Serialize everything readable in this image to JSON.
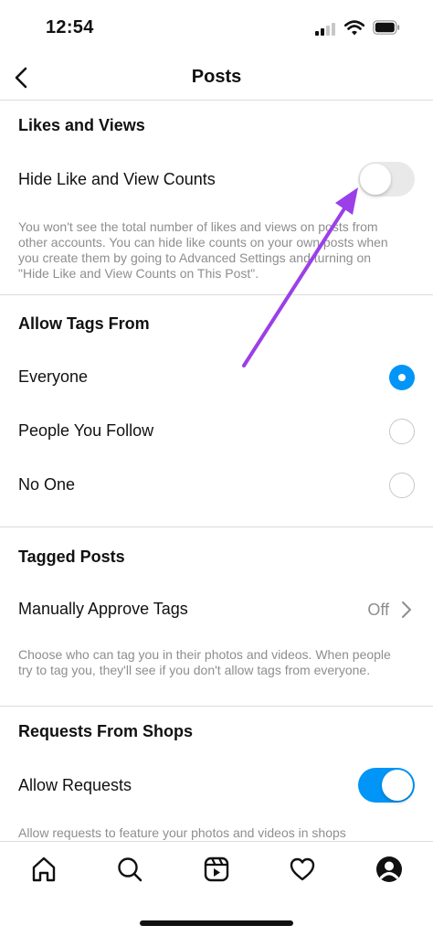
{
  "status_bar": {
    "time": "12:54"
  },
  "nav": {
    "title": "Posts"
  },
  "likes_views": {
    "title": "Likes and Views",
    "hide_counts_label": "Hide Like and View Counts",
    "hide_counts_enabled": false,
    "helper": "You won't see the total number of likes and views on posts from other accounts. You can hide like counts on your own posts when you create them by going to Advanced Settings and turning on \"Hide Like and View Counts on This Post\"."
  },
  "allow_tags": {
    "title": "Allow Tags From",
    "options": [
      {
        "label": "Everyone",
        "selected": true
      },
      {
        "label": "People You Follow",
        "selected": false
      },
      {
        "label": "No One",
        "selected": false
      }
    ]
  },
  "tagged_posts": {
    "title": "Tagged Posts",
    "manual_approve_label": "Manually Approve Tags",
    "manual_approve_value": "Off",
    "helper": "Choose who can tag you in their photos and videos. When people try to tag you, they'll see if you don't allow tags from everyone."
  },
  "shops": {
    "title": "Requests From Shops",
    "allow_requests_label": "Allow Requests",
    "allow_requests_enabled": true,
    "helper": "Allow requests to feature your photos and videos in shops"
  },
  "tab_bar": {
    "icons": [
      "home-icon",
      "search-icon",
      "reels-icon",
      "heart-icon",
      "profile-icon"
    ]
  },
  "colors": {
    "accent": "#0095f6",
    "annotation_arrow": "#9b3fe8",
    "divider": "#dbdbdb",
    "helper_text": "#8e8e8e"
  }
}
